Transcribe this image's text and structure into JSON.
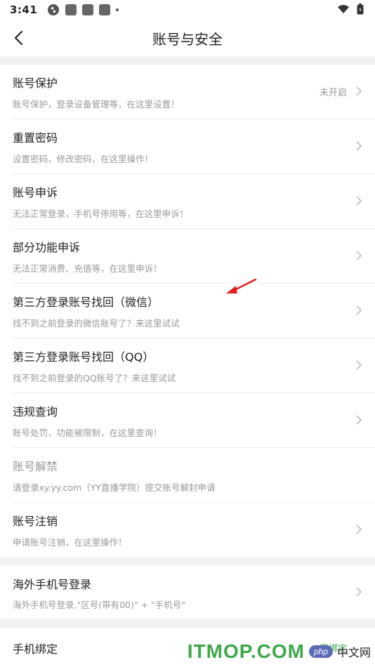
{
  "status_bar": {
    "time": "3:41"
  },
  "header": {
    "title": "账号与安全"
  },
  "items": [
    {
      "title": "账号保护",
      "subtitle": "账号保护，登录设备管理等，在这里设置！",
      "value": "未开启"
    },
    {
      "title": "重置密码",
      "subtitle": "设置密码，修改密码，在这里操作！"
    },
    {
      "title": "账号申诉",
      "subtitle": "无法正常登录，手机号停用等，在这里申诉！"
    },
    {
      "title": "部分功能申诉",
      "subtitle": "无法正常消费、充值等，在这里申诉！"
    },
    {
      "title": "第三方登录账号找回（微信）",
      "subtitle": "找不到之前登录的微信账号了？来这里试试"
    },
    {
      "title": "第三方登录账号找回（QQ）",
      "subtitle": "找不到之前登录的QQ账号了？来这里试试"
    },
    {
      "title": "违规查询",
      "subtitle": "账号处罚，功能被限制，在这里查询！"
    },
    {
      "title": "账号解禁",
      "subtitle": "请登录xy.yy.com（YY直播学院）提交账号解封申请"
    },
    {
      "title": "账号注销",
      "subtitle": "申请账号注销，在这里操作！"
    }
  ],
  "section2": [
    {
      "title": "海外手机号登录",
      "subtitle": "海外手机号登录,\"区号(带有00)\" + \"手机号\""
    }
  ],
  "section3": [
    {
      "title": "手机绑定",
      "value": "已绑定"
    }
  ],
  "watermark": {
    "brand": "ITMOP.COM",
    "php": "php",
    "cn": "中文网"
  },
  "colors": {
    "divider": "#ececec",
    "gap": "#f2f2f2",
    "subtitle": "#999999",
    "watermark_green": "#3da84a",
    "arrow_red": "#e02020"
  }
}
